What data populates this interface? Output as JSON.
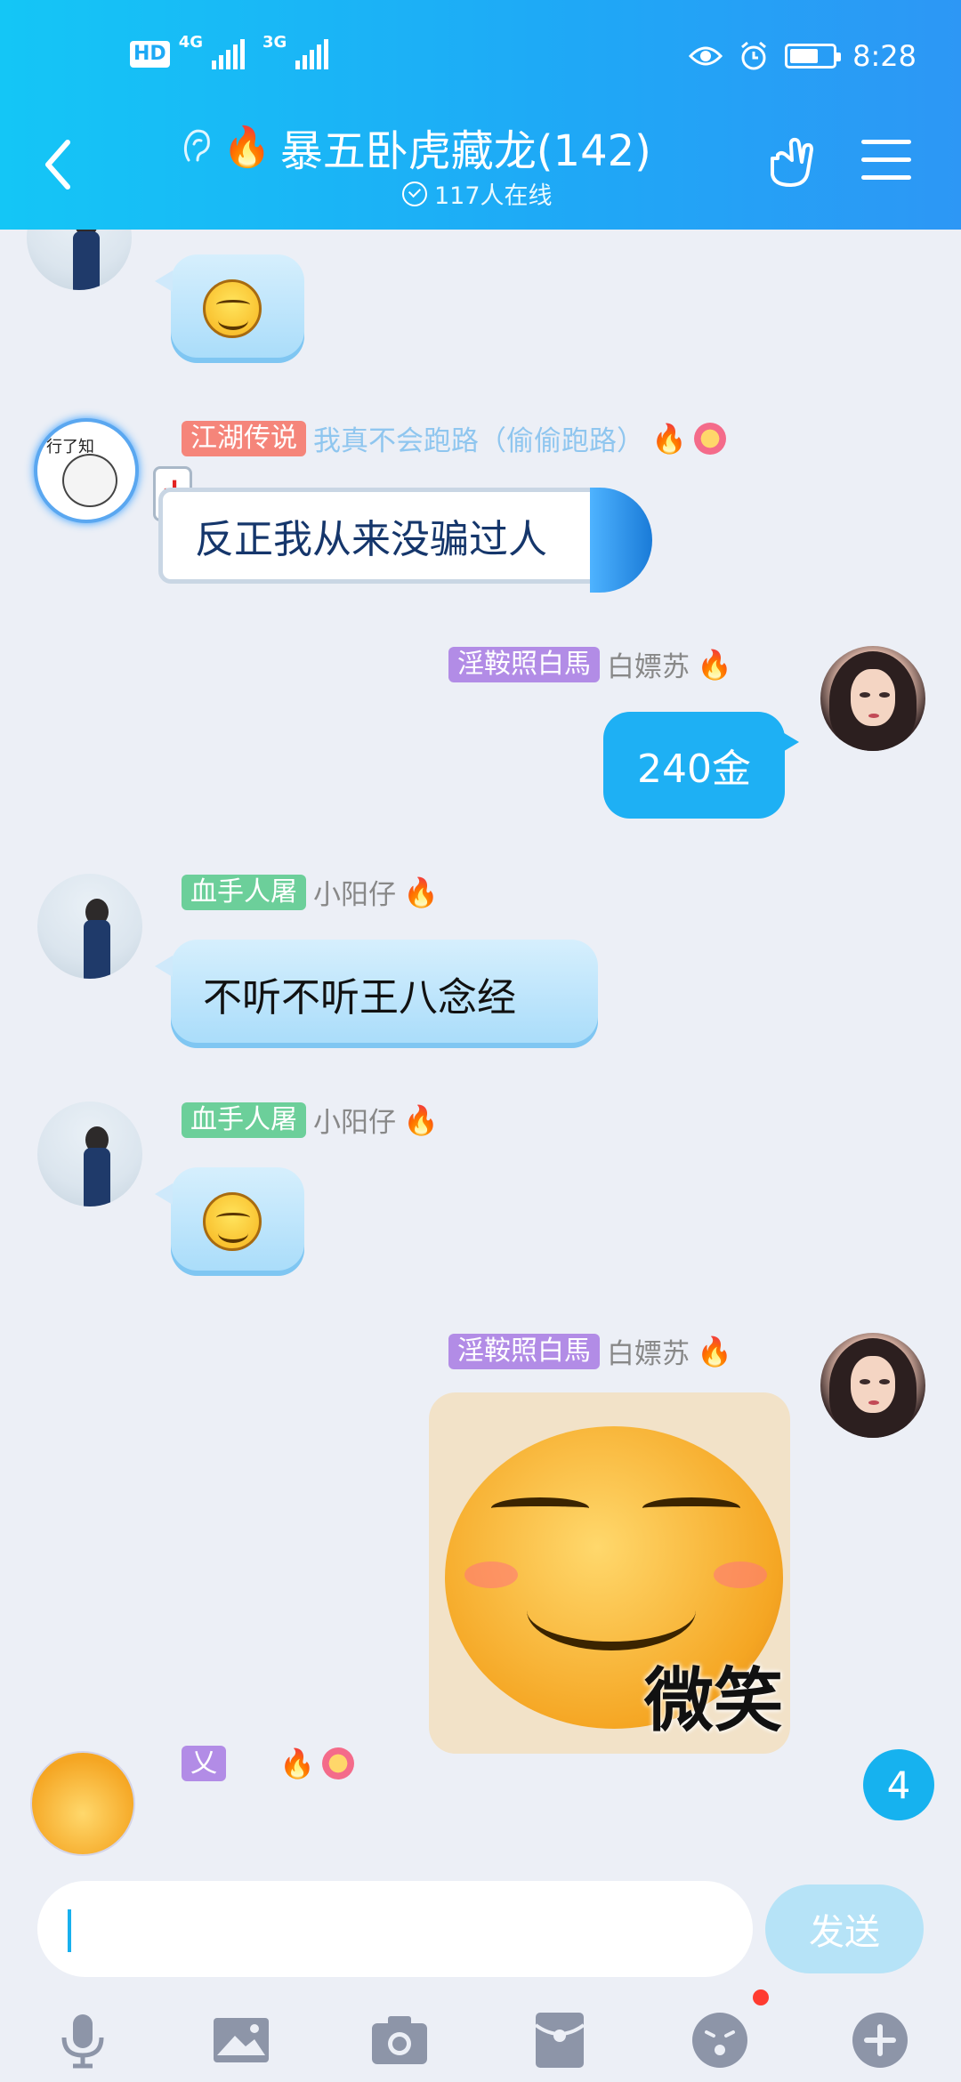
{
  "status_bar": {
    "hd": "HD",
    "net1": "4G",
    "net2": "3G",
    "time": "8:28"
  },
  "header": {
    "title": "暴五卧虎藏龙(142)",
    "online": "117人在线"
  },
  "messages": [
    {
      "id": "msg1",
      "tag": "",
      "nick": "",
      "type": "emoji"
    },
    {
      "id": "msg2",
      "tag": "江湖传说",
      "nick": "我真不会跑路（偷偷跑路）",
      "text": "反正我从来没骗过人",
      "avatar_text": "行了知",
      "flame": "🔥"
    },
    {
      "id": "msg3",
      "tag": "淫鞍照白馬",
      "nick": "白嫖苏",
      "text": "240金",
      "flame": "🔥"
    },
    {
      "id": "msg4",
      "tag": "血手人屠",
      "nick": "小阳仔",
      "text": "不听不听王八念经",
      "flame": "🔥"
    },
    {
      "id": "msg5",
      "tag": "血手人屠",
      "nick": "小阳仔",
      "type": "emoji",
      "flame": "🔥"
    },
    {
      "id": "msg6",
      "tag": "淫鞍照白馬",
      "nick": "白嫖苏",
      "sticker_label": "微笑",
      "flame": "🔥"
    },
    {
      "id": "msg7",
      "tag": "乂",
      "nick": "",
      "flame": "🔥"
    }
  ],
  "unread_count": "4",
  "input": {
    "send_label": "发送"
  },
  "colors": {
    "header_start": "#14c6f6",
    "header_end": "#2d97f5",
    "bubble_mine": "#1eb0f4",
    "send_disabled": "#b6e3f7"
  },
  "toolbar_icons": [
    "microphone-icon",
    "image-icon",
    "camera-icon",
    "red-envelope-icon",
    "emoji-icon",
    "plus-icon"
  ]
}
